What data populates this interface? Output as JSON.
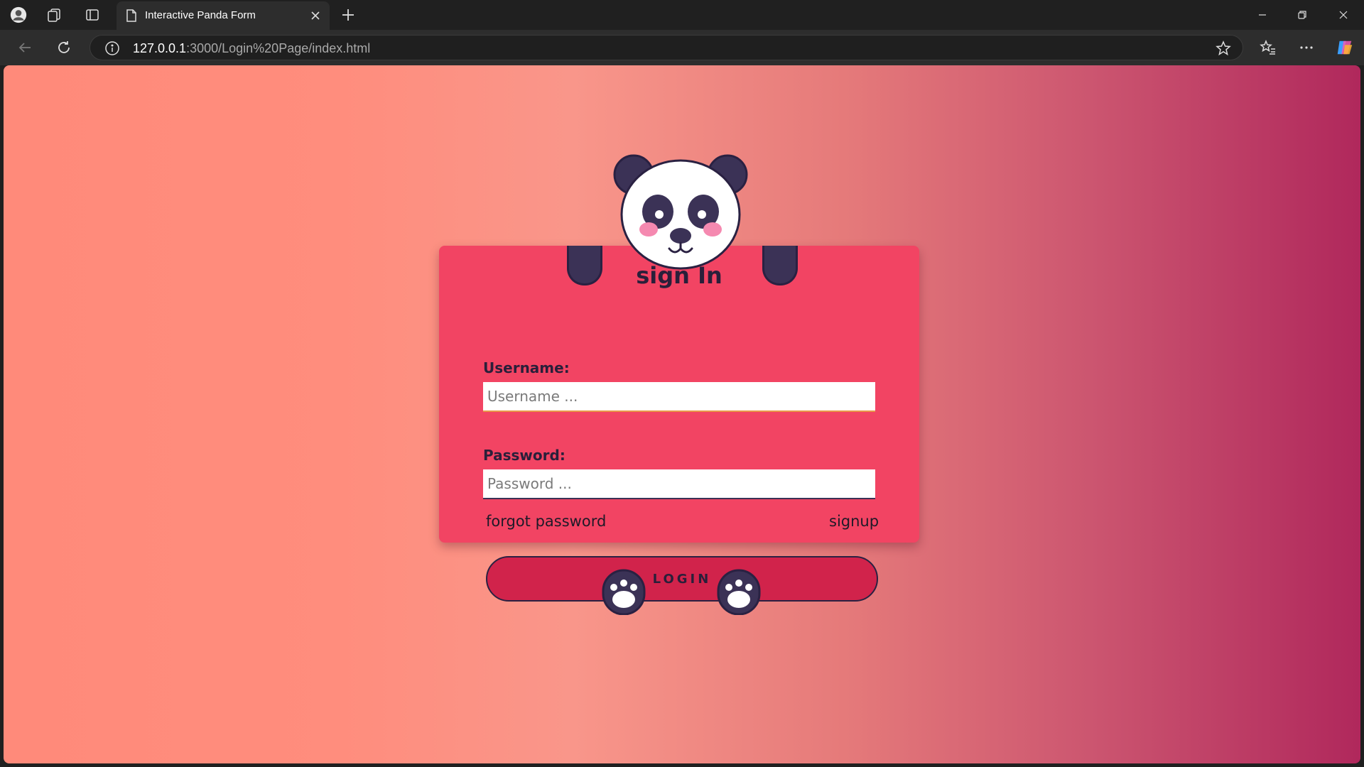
{
  "browser": {
    "tab_title": "Interactive Panda Form",
    "url_host": "127.0.0.1",
    "url_rest": ":3000/Login%20Page/index.html"
  },
  "form": {
    "title": "sign In",
    "username_label": "Username:",
    "username_placeholder": "Username ...",
    "password_label": "Password:",
    "password_placeholder": "Password ...",
    "forgot_label": "forgot password",
    "signup_label": "signup",
    "login_label": "LOGIN"
  },
  "colors": {
    "card": "#f24463",
    "button": "#d1234b",
    "panda_dark": "#3b3256",
    "text_dark": "#2a1f3a",
    "gradient_left": "#ff8a7a",
    "gradient_right": "#b0285c"
  },
  "icons": {
    "profile": "profile-icon",
    "collections": "collections-icon",
    "sidebar": "sidebar-icon",
    "page": "page-icon",
    "close": "close-icon",
    "new_tab": "plus-icon",
    "back": "back-arrow-icon",
    "refresh": "refresh-icon",
    "info": "info-icon",
    "star": "star-icon",
    "favorites": "favorites-icon",
    "more": "more-icon",
    "copilot": "copilot-icon"
  }
}
